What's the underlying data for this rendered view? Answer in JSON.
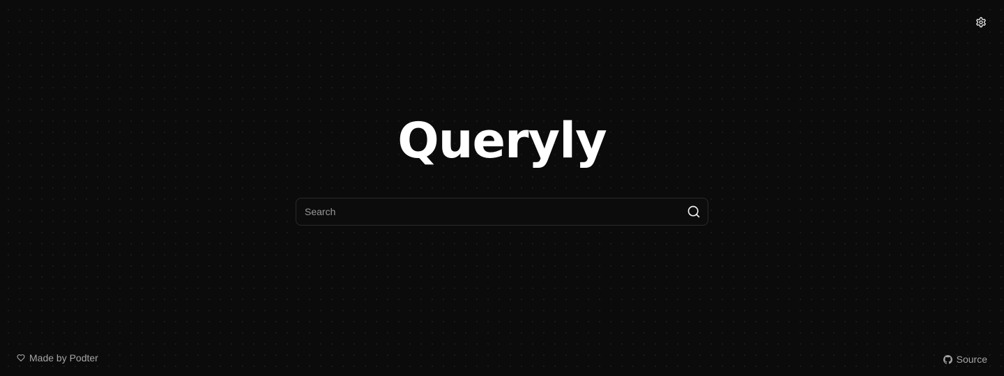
{
  "app": {
    "logo_text": "Queryly"
  },
  "search": {
    "placeholder": "Search",
    "value": "",
    "submit_icon": "search-icon"
  },
  "header": {
    "settings_icon": "gear-icon"
  },
  "footer": {
    "credit_icon": "heart-icon",
    "credit_text": "Made by Podter",
    "source_icon": "github-icon",
    "source_text": "Source"
  },
  "colors": {
    "background": "#0b0b0b",
    "text": "#ffffff",
    "muted_text": "#a6a6a6",
    "border": "#2a2a2a"
  }
}
